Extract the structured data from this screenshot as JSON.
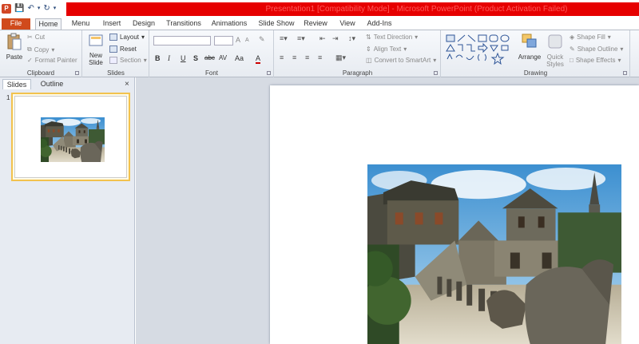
{
  "window": {
    "title": "Presentation1 [Compatibility Mode] - Microsoft PowerPoint (Product Activation Failed)"
  },
  "qat": {
    "app_letter": "P",
    "items": [
      "save-icon",
      "undo-icon",
      "redo-icon",
      "customize-icon"
    ]
  },
  "tabs": [
    "File",
    "Home",
    "Menu",
    "Insert",
    "Design",
    "Transitions",
    "Animations",
    "Slide Show",
    "Review",
    "View",
    "Add-Ins"
  ],
  "ribbon": {
    "clipboard": {
      "label": "Clipboard",
      "paste": "Paste",
      "cut": "Cut",
      "copy": "Copy",
      "format_painter": "Format Painter"
    },
    "slides": {
      "label": "Slides",
      "new_slide": "New Slide",
      "layout": "Layout",
      "reset": "Reset",
      "section": "Section"
    },
    "font": {
      "label": "Font",
      "font_name": "",
      "font_size": "",
      "grow": "A",
      "shrink": "A",
      "bold": "B",
      "italic": "I",
      "underline": "U",
      "shadow": "S",
      "strike": "abc",
      "spacing": "AV",
      "case": "Aa",
      "color": "A"
    },
    "paragraph": {
      "label": "Paragraph",
      "text_direction": "Text Direction",
      "align_text": "Align Text",
      "convert": "Convert to SmartArt"
    },
    "drawing": {
      "label": "Drawing",
      "arrange": "Arrange",
      "quick_styles": "Quick Styles",
      "shape_fill": "Shape Fill",
      "shape_outline": "Shape Outline",
      "shape_effects": "Shape Effects"
    }
  },
  "pane": {
    "tab_slides": "Slides",
    "tab_outline": "Outline",
    "close": "×",
    "thumb_number": "1"
  },
  "colors": {
    "accent": "#d04a1c",
    "title_bar": "#e60000",
    "selection": "#f2c24e"
  }
}
